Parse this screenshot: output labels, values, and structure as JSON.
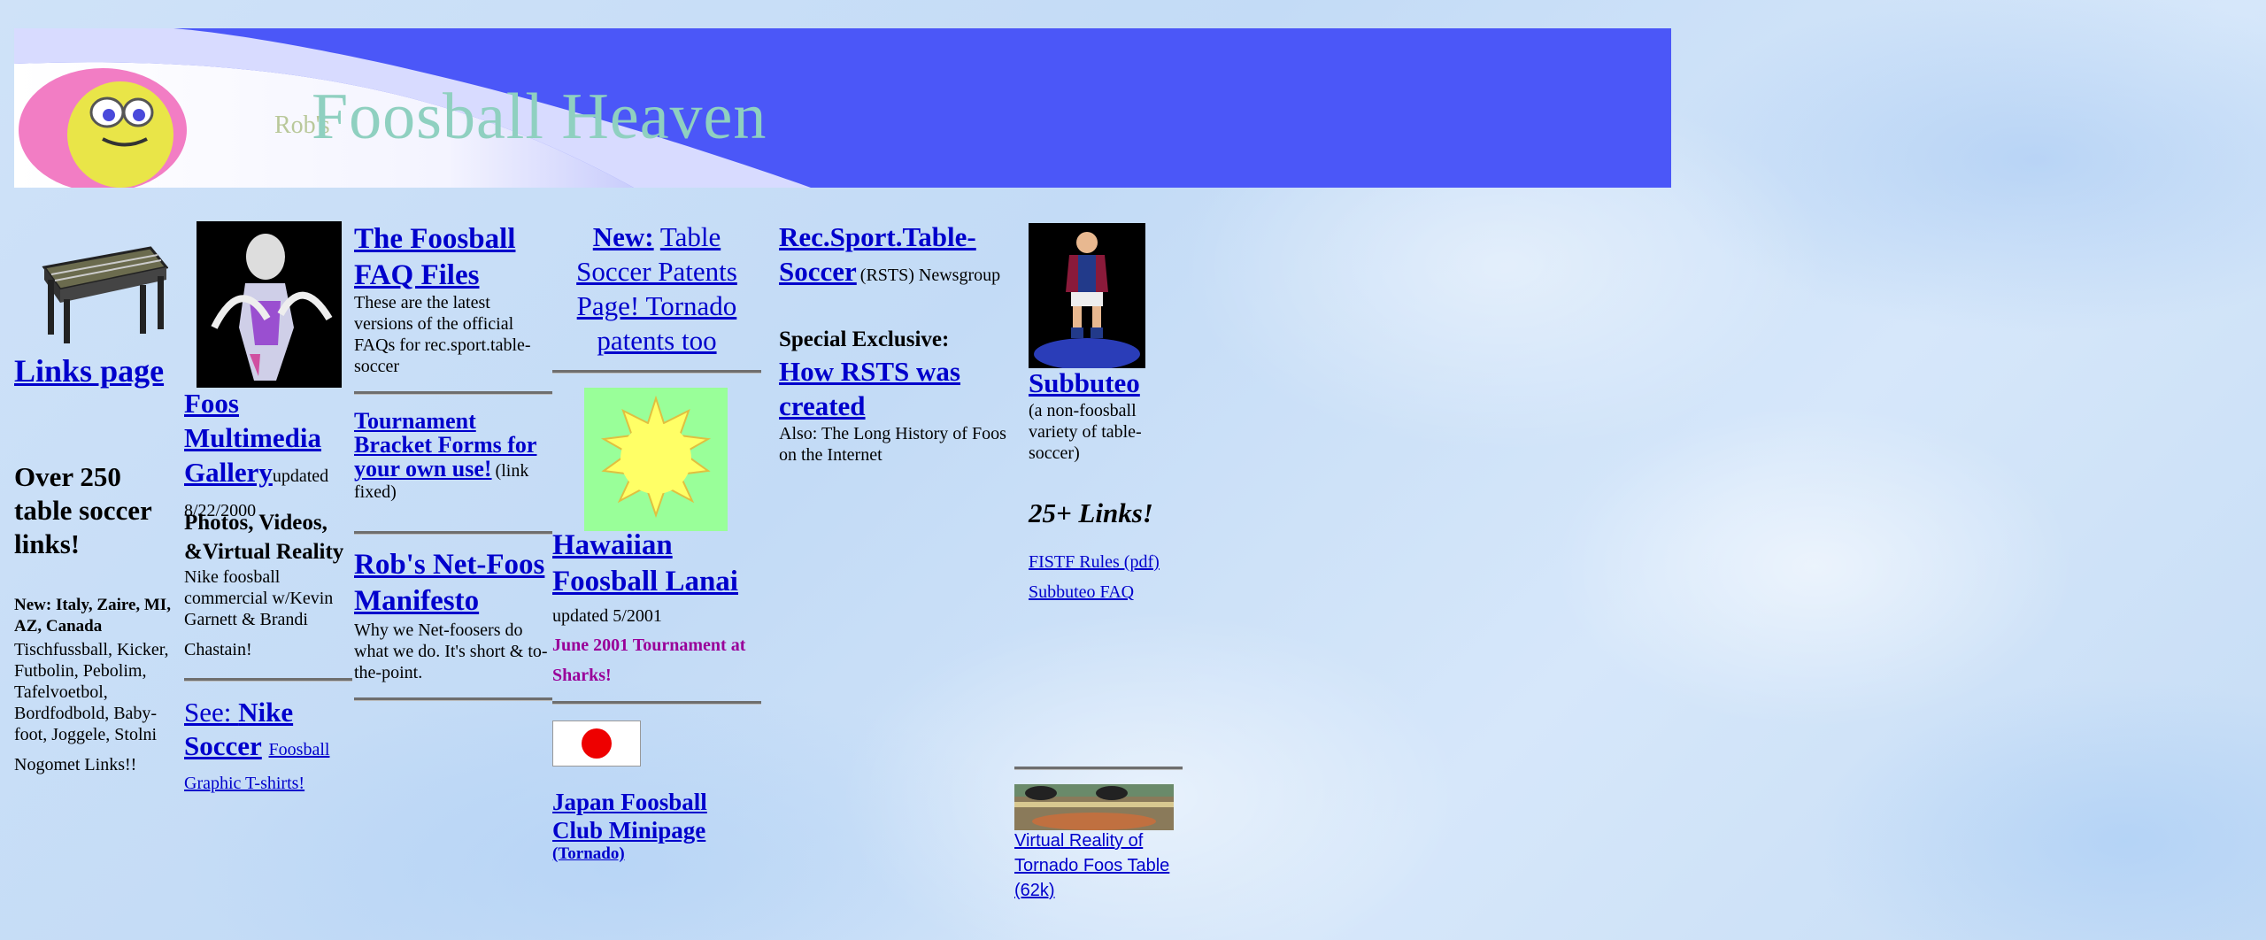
{
  "banner": {
    "prefix": "Rob's",
    "title": "Foosball Heaven"
  },
  "col1": {
    "links_page": "Links page",
    "headline": "Over 250 table soccer links!",
    "new_label": "New: Italy, Zaire, MI, AZ, Canada",
    "names": "Tischfussball, Kicker, Futbolin, Pebolim, Tafelvoetbol, Bordfodbold, Baby-foot, Joggele, Stolni",
    "names_tail": "Nogomet Links!!"
  },
  "col2": {
    "gallery_link": "Foos Multimedia Gallery",
    "updated": "updated 8/22/2000",
    "photos": "Photos, Videos, &Virtual Reality",
    "nike_text": "Nike foosball commercial w/Kevin Garnett & Brandi",
    "nike_tail": "Chastain!",
    "see_label": "See: ",
    "nike_soccer": "Nike Soccer",
    "tshirts_a": "Foosball",
    "tshirts_b": "Graphic T-shirts!"
  },
  "col3": {
    "faq_link": "The Foosball FAQ Files",
    "faq_desc": "These are the latest versions of the official FAQs for rec.sport.table-soccer",
    "tournament_link": "Tournament Bracket Forms for your own use!",
    "tournament_note": "(link fixed)",
    "manifesto_link": "Rob's Net-Foos Manifesto",
    "manifesto_desc": "Why we Net-foosers do what we do. It's short & to-the-point."
  },
  "col4": {
    "new_bold": "New:",
    "patents": "Table Soccer Patents Page! Tornado patents too",
    "hawaii_link": "Hawaiian Foosball Lanai",
    "hawaii_updated": "updated 5/2001",
    "hawaii_tournament": "June 2001 Tournament at Sharks!",
    "japan_link": "Japan Foosball Club Minipage",
    "japan_sub": "(Tornado)"
  },
  "col5": {
    "rsts_link": "Rec.Sport.Table-Soccer",
    "rsts_note": "(RSTS) Newsgroup",
    "exclusive": "Special Exclusive:",
    "rsts_created": "How RSTS was created",
    "history": "Also: The Long History of Foos on the Internet"
  },
  "col6": {
    "subbuteo_link": "Subbuteo",
    "subbuteo_desc": "(a non-foosball variety of table-soccer)",
    "links_count": "25+ Links!",
    "fistf": "FISTF Rules (pdf)",
    "subbuteo_faq": "Subbuteo FAQ",
    "vr_link": "Virtual Reality of Tornado Foos Table (62k)"
  },
  "colors": {
    "banner_blue": "#4b57f8",
    "link": "#0000cc",
    "purple": "#990099",
    "sun": "#ffff66",
    "sun_bg": "#99ff99",
    "flag_red": "#ee0000"
  }
}
